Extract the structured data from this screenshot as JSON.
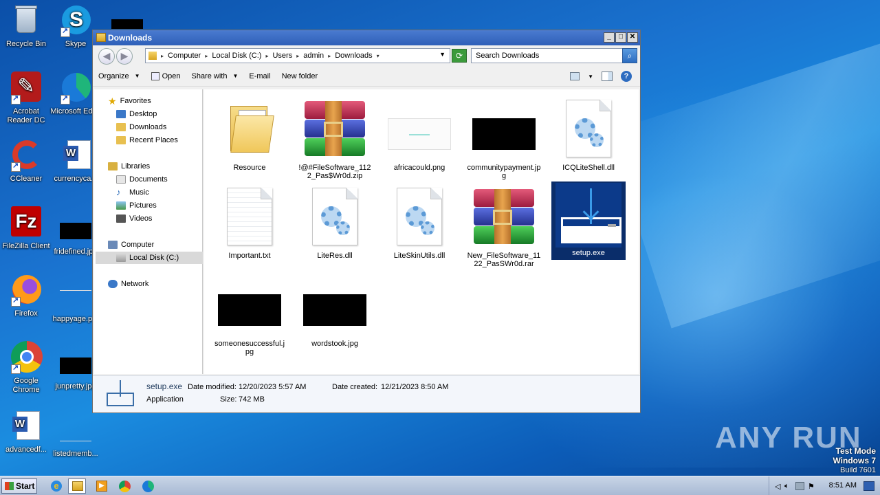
{
  "desktop": {
    "icons": [
      {
        "label": "Recycle Bin",
        "icon": "recycle-bin-icon"
      },
      {
        "label": "Skype",
        "icon": "skype-icon"
      },
      {
        "label": "Acrobat Reader DC",
        "icon": "acrobat-icon"
      },
      {
        "label": "Microsoft Edge",
        "icon": "edge-icon"
      },
      {
        "label": "CCleaner",
        "icon": "ccleaner-icon"
      },
      {
        "label": "currencyca...",
        "icon": "word-doc-icon"
      },
      {
        "label": "FileZilla Client",
        "icon": "filezilla-icon"
      },
      {
        "label": "fridefined.jpg",
        "icon": "image-file-icon"
      },
      {
        "label": "Firefox",
        "icon": "firefox-icon"
      },
      {
        "label": "happyage.p...",
        "icon": "image-file-icon"
      },
      {
        "label": "Google Chrome",
        "icon": "chrome-icon"
      },
      {
        "label": "junpretty.jpg",
        "icon": "image-file-icon"
      },
      {
        "label": "advancedf...",
        "icon": "word-doc-icon"
      },
      {
        "label": "listedmemb...",
        "icon": "image-file-icon"
      }
    ]
  },
  "window": {
    "title": "Downloads",
    "breadcrumbs": [
      "Computer",
      "Local Disk (C:)",
      "Users",
      "admin",
      "Downloads"
    ],
    "search_placeholder": "Search Downloads",
    "toolbar": {
      "organize": "Organize",
      "open": "Open",
      "share_with": "Share with",
      "email": "E-mail",
      "new_folder": "New folder"
    },
    "nav": {
      "favorites": "Favorites",
      "desktop": "Desktop",
      "downloads": "Downloads",
      "recent_places": "Recent Places",
      "libraries": "Libraries",
      "documents": "Documents",
      "music": "Music",
      "pictures": "Pictures",
      "videos": "Videos",
      "computer": "Computer",
      "local_disk": "Local Disk (C:)",
      "network": "Network"
    },
    "files": [
      {
        "name": "Resource",
        "type": "folder"
      },
      {
        "name": "!@#FileSoftware_1122_Pas$Wr0d.zip",
        "type": "archive"
      },
      {
        "name": "africacould.png",
        "type": "image-white"
      },
      {
        "name": "communitypayment.jpg",
        "type": "image-black"
      },
      {
        "name": "ICQLiteShell.dll",
        "type": "dll"
      },
      {
        "name": "Important.txt",
        "type": "text"
      },
      {
        "name": "LiteRes.dll",
        "type": "dll"
      },
      {
        "name": "LiteSkinUtils.dll",
        "type": "dll"
      },
      {
        "name": "New_FileSoftware_1122_PasSWr0d.rar",
        "type": "archive"
      },
      {
        "name": "setup.exe",
        "type": "installer",
        "selected": true
      },
      {
        "name": "someonesuccessful.jpg",
        "type": "image-black"
      },
      {
        "name": "wordstook.jpg",
        "type": "image-black"
      }
    ],
    "details": {
      "name": "setup.exe",
      "type": "Application",
      "modified_label": "Date modified:",
      "modified": "12/20/2023 5:57 AM",
      "created_label": "Date created:",
      "created": "12/21/2023 8:50 AM",
      "size_label": "Size:",
      "size": "742 MB"
    }
  },
  "taskbar": {
    "start": "Start",
    "clock": "8:51 AM"
  },
  "watermark": {
    "mode": "Test Mode",
    "os": "Windows 7",
    "build": "Build 7601",
    "brand": "ANY RUN"
  },
  "colors": {
    "selection": "#0a2d6a",
    "titlebar": "#2e5fb8",
    "desktop": "#1a73d0"
  }
}
